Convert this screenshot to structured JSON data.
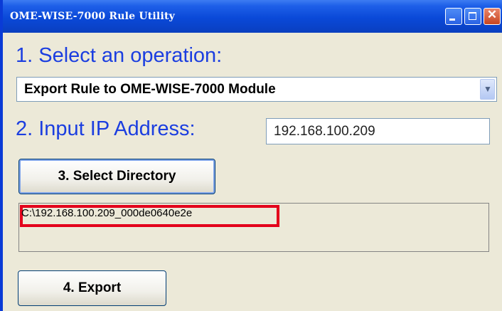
{
  "window": {
    "title": "OME-WISE-7000 Rule Utility",
    "controls": [
      "minimize-icon",
      "maximize-icon",
      "close-icon"
    ]
  },
  "step1": {
    "label": "1. Select an operation:",
    "selected_option": "Export Rule to OME-WISE-7000 Module"
  },
  "step2": {
    "label": "2. Input IP Address:",
    "ip_value": "192.168.100.209"
  },
  "step3": {
    "button_label": "3. Select Directory",
    "directory": "C:\\192.168.100.209_000de0640e2e"
  },
  "step4": {
    "button_label": "4. Export"
  },
  "colors": {
    "heading": "#1b3ee0",
    "titlebar": "#0a49d8",
    "highlight": "#e3001b",
    "window_bg": "#ece9d8"
  }
}
